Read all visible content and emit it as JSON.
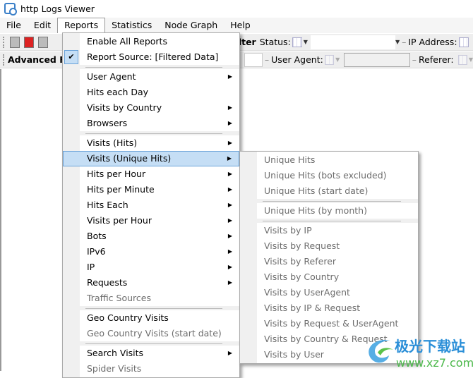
{
  "window": {
    "title": "http Logs Viewer"
  },
  "menubar": [
    "File",
    "Edit",
    "Reports",
    "Statistics",
    "Node Graph",
    "Help"
  ],
  "toolbar1": {
    "filter_label": "Filter",
    "status_label": "Status:",
    "ip_label": "IP Address:"
  },
  "toolbar2": {
    "advanced_label": "Advanced Filt",
    "user_agent_label": "User Agent:",
    "referer_label": "Referer:"
  },
  "reports_menu": [
    {
      "label": "Enable All Reports"
    },
    {
      "label": "Report Source: [Filtered Data]",
      "checked": true
    },
    {
      "sep": true
    },
    {
      "label": "User Agent",
      "sub": true
    },
    {
      "label": "Hits each Day"
    },
    {
      "label": "Visits by Country",
      "sub": true
    },
    {
      "label": "Browsers",
      "sub": true
    },
    {
      "sep": true
    },
    {
      "label": "Visits (Hits)",
      "sub": true
    },
    {
      "label": "Visits (Unique Hits)",
      "sub": true,
      "highlighted": true
    },
    {
      "label": "Hits per Hour",
      "sub": true
    },
    {
      "label": "Hits per Minute",
      "sub": true
    },
    {
      "label": "Hits Each",
      "sub": true
    },
    {
      "label": "Visits per Hour",
      "sub": true
    },
    {
      "label": "Bots",
      "sub": true
    },
    {
      "label": "IPv6",
      "sub": true
    },
    {
      "label": "IP",
      "sub": true
    },
    {
      "label": "Requests",
      "sub": true
    },
    {
      "label": "Traffic Sources",
      "disabled": true
    },
    {
      "sep": true
    },
    {
      "label": "Geo Country Visits"
    },
    {
      "label": "Geo Country Visits (start date)",
      "disabled": true
    },
    {
      "sep": true
    },
    {
      "label": "Search Visits",
      "sub": true
    },
    {
      "label": "Spider Visits",
      "disabled": true
    }
  ],
  "unique_submenu": [
    {
      "label": "Unique Hits",
      "disabled": true
    },
    {
      "label": "Unique Hits (bots excluded)",
      "disabled": true
    },
    {
      "label": "Unique Hits (start date)",
      "disabled": true
    },
    {
      "sep": true
    },
    {
      "label": "Unique Hits (by month)",
      "disabled": true
    },
    {
      "sep": true
    },
    {
      "label": "Visits by IP",
      "disabled": true
    },
    {
      "label": "Visits by Request",
      "disabled": true
    },
    {
      "label": "Visits by Referer",
      "disabled": true
    },
    {
      "label": "Visits by Country",
      "disabled": true
    },
    {
      "label": "Visits by UserAgent",
      "disabled": true
    },
    {
      "label": "Visits by IP & Request",
      "disabled": true
    },
    {
      "label": "Visits by Request & UserAgent",
      "disabled": true
    },
    {
      "label": "Visits by Country & Request",
      "disabled": true
    },
    {
      "label": "Visits by User",
      "disabled": true
    }
  ],
  "watermark": {
    "text": "极光下载站",
    "url": "www.xz7.com"
  }
}
